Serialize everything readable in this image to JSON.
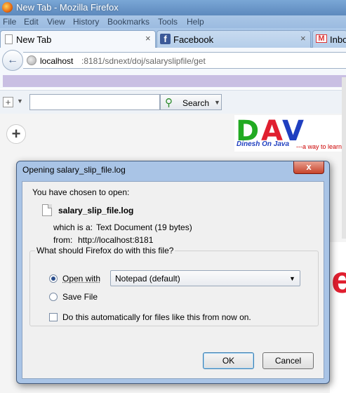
{
  "window": {
    "title": "New Tab - Mozilla Firefox"
  },
  "menubar": [
    "File",
    "Edit",
    "View",
    "History",
    "Bookmarks",
    "Tools",
    "Help"
  ],
  "tabs": [
    {
      "label": "New Tab",
      "close": "×"
    },
    {
      "label": "Facebook",
      "close": "×"
    },
    {
      "label": "Inbo"
    }
  ],
  "nav": {
    "url_host": "localhost",
    "url_path": ":8181/sdnext/doj/salaryslipfile/get"
  },
  "search": {
    "button_label": "Search",
    "value": ""
  },
  "logo": {
    "letters": [
      "D",
      "A",
      "V"
    ],
    "subtitle": "Dinesh On Java",
    "tagline": "---a way to learn"
  },
  "dialog": {
    "title": "Opening salary_slip_file.log",
    "close": "x",
    "chosen_text": "You have chosen to open:",
    "filename": "salary_slip_file.log",
    "which_is_label": "which is a:",
    "which_is_value": "Text Document (19 bytes)",
    "from_label": "from:",
    "from_value": "http://localhost:8181",
    "question": "What should Firefox do with this file?",
    "open_with_label": "Open with",
    "open_with_app": "Notepad (default)",
    "save_file_label": "Save File",
    "auto_label": "Do this automatically for files like this from now on.",
    "ok_label": "OK",
    "cancel_label": "Cancel",
    "open_with_selected": true,
    "auto_checked": false
  }
}
